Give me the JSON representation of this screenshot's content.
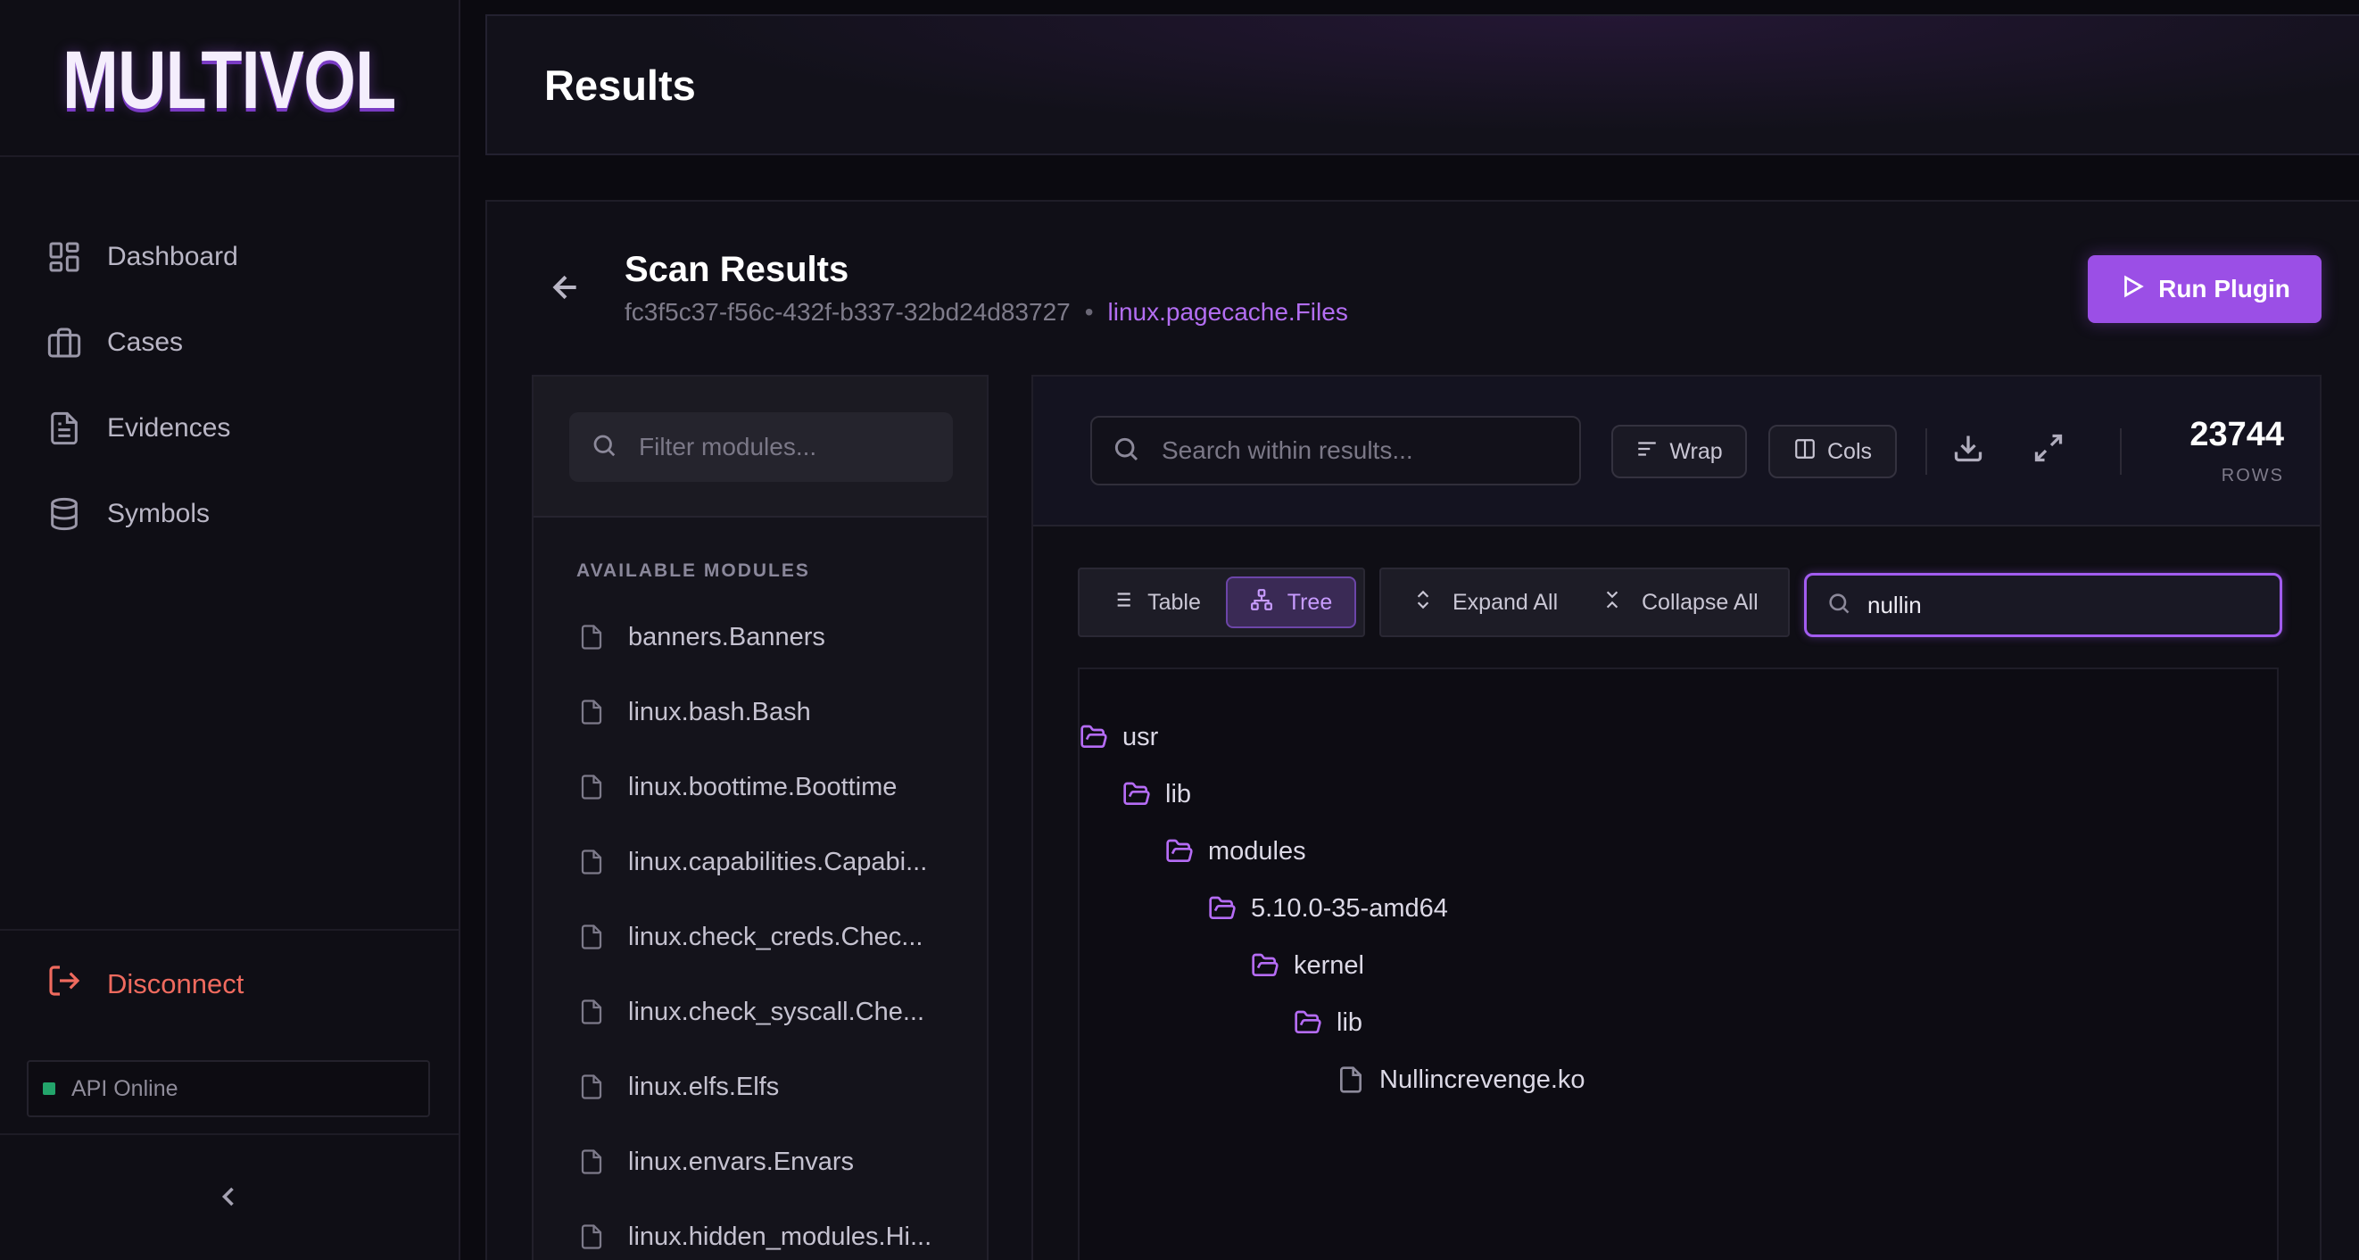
{
  "app": {
    "logo_text": "MULTIVOL",
    "page_title": "Results"
  },
  "sidebar": {
    "items": [
      {
        "label": "Dashboard",
        "icon": "dashboard-grid-icon"
      },
      {
        "label": "Cases",
        "icon": "briefcase-icon"
      },
      {
        "label": "Evidences",
        "icon": "document-icon"
      },
      {
        "label": "Symbols",
        "icon": "database-icon"
      }
    ],
    "disconnect_label": "Disconnect",
    "api_status": "API Online",
    "api_status_color": "#23a56b",
    "collapse_icon": "chevron-left-icon"
  },
  "scan": {
    "title": "Scan Results",
    "id": "fc3f5c37-f56c-432f-b337-32bd24d83727",
    "separator": "•",
    "plugin": "linux.pagecache.Files",
    "run_label": "Run Plugin"
  },
  "modules": {
    "filter_placeholder": "Filter modules...",
    "section_label": "AVAILABLE MODULES",
    "items": [
      "banners.Banners",
      "linux.bash.Bash",
      "linux.boottime.Boottime",
      "linux.capabilities.Capabi...",
      "linux.check_creds.Chec...",
      "linux.check_syscall.Che...",
      "linux.elfs.Elfs",
      "linux.envars.Envars",
      "linux.hidden_modules.Hi..."
    ]
  },
  "results": {
    "search_placeholder": "Search within results...",
    "wrap_label": "Wrap",
    "cols_label": "Cols",
    "rows_count": "23744",
    "rows_label": "ROWS",
    "view_table": "Table",
    "view_tree": "Tree",
    "expand_all": "Expand All",
    "collapse_all": "Collapse All",
    "tree_search_value": "nullin",
    "tree": [
      {
        "label": "usr",
        "type": "folder",
        "depth": 0
      },
      {
        "label": "lib",
        "type": "folder",
        "depth": 1
      },
      {
        "label": "modules",
        "type": "folder",
        "depth": 2
      },
      {
        "label": "5.10.0-35-amd64",
        "type": "folder",
        "depth": 3
      },
      {
        "label": "kernel",
        "type": "folder",
        "depth": 4
      },
      {
        "label": "lib",
        "type": "folder",
        "depth": 5
      },
      {
        "label": "Nullincrevenge.ko",
        "type": "file",
        "depth": 6
      }
    ]
  },
  "colors": {
    "accent": "#9b4fe6",
    "plugin_link": "#b36ef2",
    "danger": "#ef6a5e",
    "background": "#0b0a10"
  }
}
